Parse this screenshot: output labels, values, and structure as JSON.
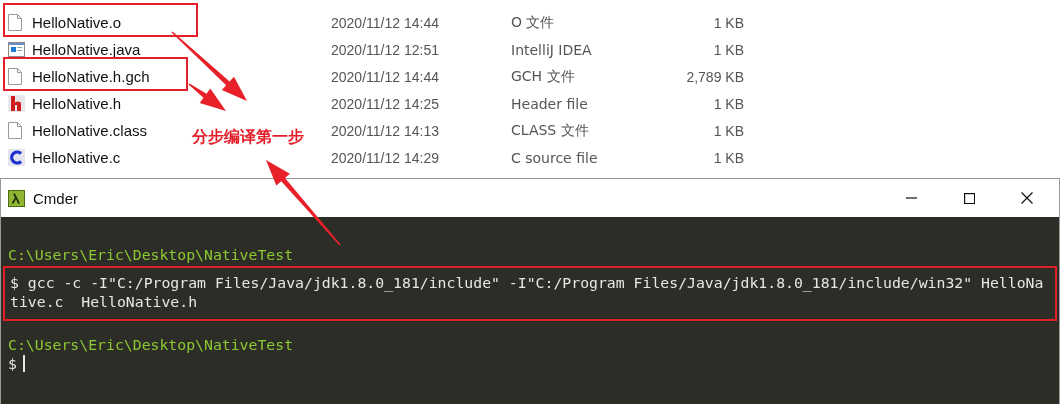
{
  "files": [
    {
      "kind": "blank",
      "name": "HelloNative.o",
      "date": "2020/11/12 14:44",
      "type": "O 文件",
      "size": "1 KB",
      "highlighted": true
    },
    {
      "kind": "java",
      "name": "HelloNative.java",
      "date": "2020/11/12 12:51",
      "type": "IntelliJ IDEA",
      "size": "1 KB",
      "highlighted": false
    },
    {
      "kind": "blank",
      "name": "HelloNative.h.gch",
      "date": "2020/11/12 14:44",
      "type": "GCH 文件",
      "size": "2,789 KB",
      "highlighted": true
    },
    {
      "kind": "header",
      "name": "HelloNative.h",
      "date": "2020/11/12 14:25",
      "type": "Header file",
      "size": "1 KB",
      "highlighted": false
    },
    {
      "kind": "blank",
      "name": "HelloNative.class",
      "date": "2020/11/12 14:13",
      "type": "CLASS 文件",
      "size": "1 KB",
      "highlighted": false
    },
    {
      "kind": "csource",
      "name": "HelloNative.c",
      "date": "2020/11/12 14:29",
      "type": "C source file",
      "size": "1 KB",
      "highlighted": false
    }
  ],
  "annotation": "分步编译第一步",
  "terminal": {
    "title": "Cmder",
    "lines": [
      {
        "kind": "path",
        "text": "C:\\Users\\Eric\\Desktop\\NativeTest",
        "highlighted": false
      },
      {
        "kind": "command",
        "text": "$ gcc -c -I\"C:/Program Files/Java/jdk1.8.0_181/include\" -I\"C:/Program Files/Java/jdk1.8.0_181/include/win32\" HelloNa",
        "highlighted": true
      },
      {
        "kind": "command",
        "text": "tive.c  HelloNative.h",
        "highlighted": true
      },
      {
        "kind": "path",
        "text": "C:\\Users\\Eric\\Desktop\\NativeTest",
        "highlighted": false
      },
      {
        "kind": "prompt",
        "text": "$",
        "highlighted": false
      }
    ]
  }
}
